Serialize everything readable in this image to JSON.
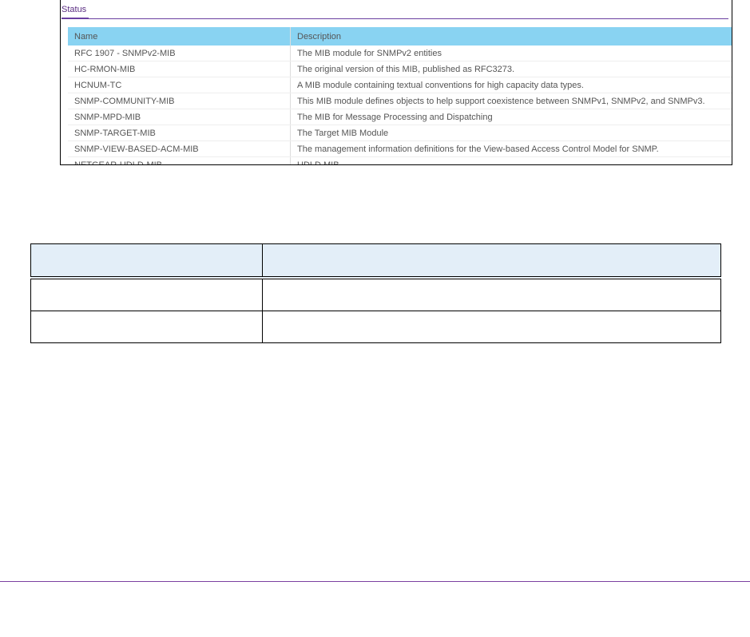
{
  "screenshot": {
    "tab": "Status",
    "columns": [
      "Name",
      "Description"
    ],
    "rows": [
      [
        "RFC 1907 - SNMPv2-MIB",
        "The MIB module for SNMPv2 entities"
      ],
      [
        "HC-RMON-MIB",
        "The original version of this MIB, published as RFC3273."
      ],
      [
        "HCNUM-TC",
        "A MIB module containing textual conventions for high capacity data types."
      ],
      [
        "SNMP-COMMUNITY-MIB",
        "This MIB module defines objects to help support coexistence between SNMPv1, SNMPv2, and SNMPv3."
      ],
      [
        "SNMP-MPD-MIB",
        "The MIB for Message Processing and Dispatching"
      ],
      [
        "SNMP-TARGET-MIB",
        "The Target MIB Module"
      ],
      [
        "SNMP-VIEW-BASED-ACM-MIB",
        "The management information definitions for the View-based Access Control Model for SNMP."
      ],
      [
        "NETGEAR-UDLD-MIB",
        "UDLD MIB"
      ]
    ]
  }
}
